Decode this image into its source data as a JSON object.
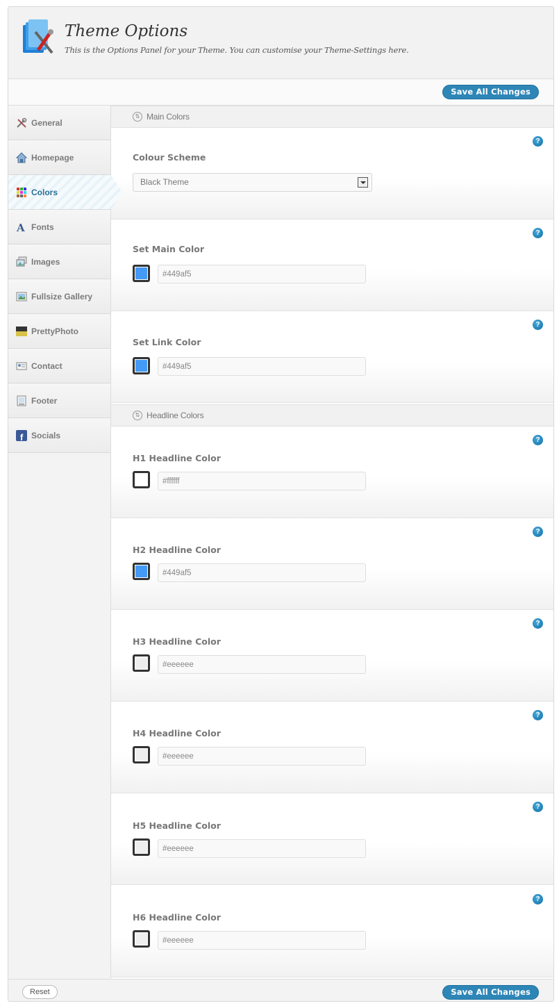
{
  "header": {
    "title": "Theme Options",
    "subtitle": "This is the Options Panel for your Theme. You can customise your Theme-Settings here."
  },
  "toolbar": {
    "save_label": "Save All Changes"
  },
  "sidebar": {
    "items": [
      {
        "label": "General",
        "icon": "tools-icon"
      },
      {
        "label": "Homepage",
        "icon": "home-icon"
      },
      {
        "label": "Colors",
        "icon": "palette-icon",
        "active": true
      },
      {
        "label": "Fonts",
        "icon": "font-icon"
      },
      {
        "label": "Images",
        "icon": "images-icon"
      },
      {
        "label": "Fullsize Gallery",
        "icon": "gallery-icon"
      },
      {
        "label": "PrettyPhoto",
        "icon": "prettyphoto-icon"
      },
      {
        "label": "Contact",
        "icon": "contact-card-icon"
      },
      {
        "label": "Footer",
        "icon": "footer-icon"
      },
      {
        "label": "Socials",
        "icon": "facebook-icon"
      }
    ]
  },
  "sections": {
    "main": {
      "label": "Main Colors"
    },
    "headline": {
      "label": "Headline Colors"
    }
  },
  "options": {
    "colour_scheme": {
      "label": "Colour Scheme",
      "selected": "Black Theme"
    },
    "main_color": {
      "label": "Set Main Color",
      "value": "#449af5"
    },
    "link_color": {
      "label": "Set Link Color",
      "value": "#449af5"
    },
    "h1": {
      "label": "H1 Headline Color",
      "value": "#ffffff"
    },
    "h2": {
      "label": "H2 Headline Color",
      "value": "#449af5"
    },
    "h3": {
      "label": "H3 Headline Color",
      "value": "#eeeeee"
    },
    "h4": {
      "label": "H4 Headline Color",
      "value": "#eeeeee"
    },
    "h5": {
      "label": "H5 Headline Color",
      "value": "#eeeeee"
    },
    "h6": {
      "label": "H6 Headline Color",
      "value": "#eeeeee"
    }
  },
  "help_label": "?",
  "footer": {
    "reset_label": "Reset",
    "save_label": "Save All Changes"
  },
  "colors": {
    "accent": "#2e86b7",
    "active_nav_text": "#2a6f99"
  }
}
